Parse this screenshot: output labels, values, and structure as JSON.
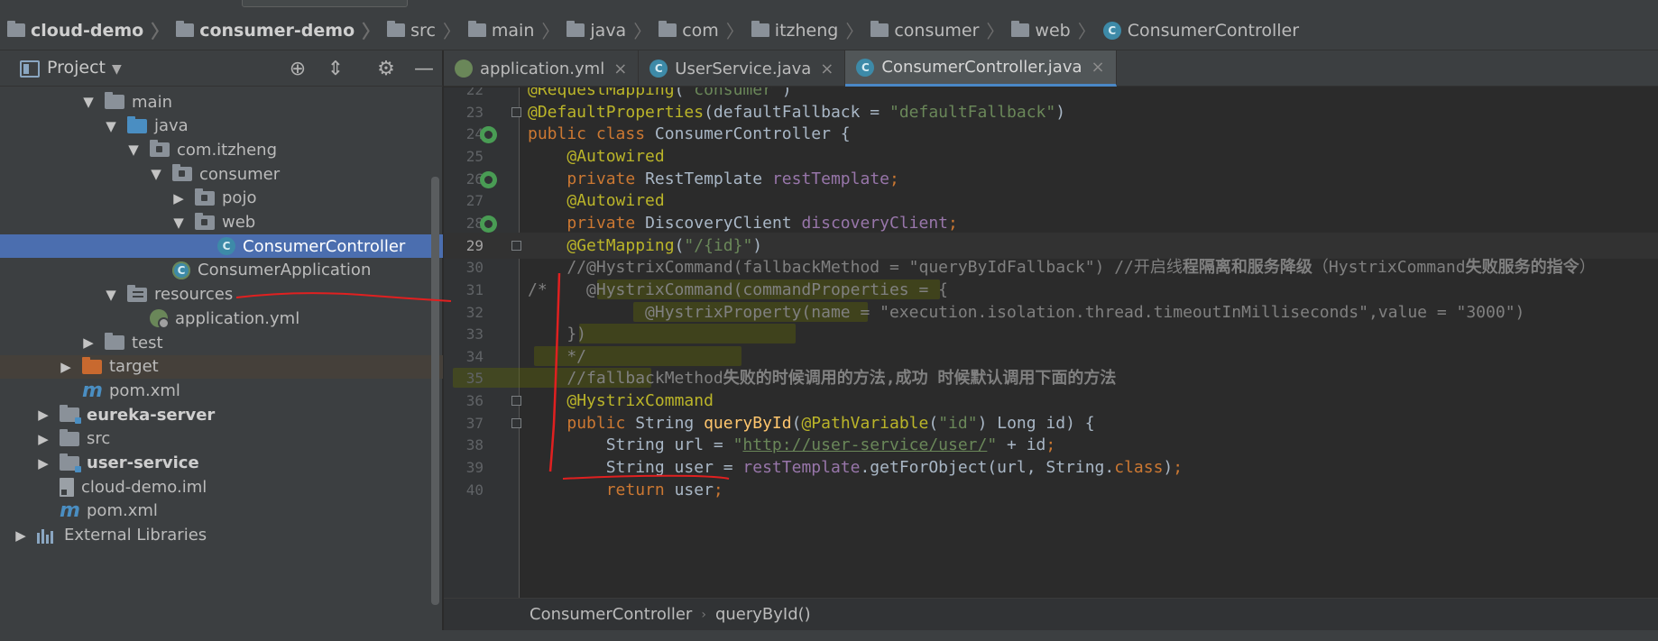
{
  "breadcrumb": [
    {
      "label": "cloud-demo",
      "icon": "module-folder-icon",
      "bold": true
    },
    {
      "label": "consumer-demo",
      "icon": "module-folder-icon",
      "bold": true
    },
    {
      "label": "src",
      "icon": "folder-icon",
      "bold": false
    },
    {
      "label": "main",
      "icon": "folder-icon",
      "bold": false
    },
    {
      "label": "java",
      "icon": "folder-icon",
      "bold": false
    },
    {
      "label": "com",
      "icon": "folder-icon",
      "bold": false
    },
    {
      "label": "itzheng",
      "icon": "folder-icon",
      "bold": false
    },
    {
      "label": "consumer",
      "icon": "folder-icon",
      "bold": false
    },
    {
      "label": "web",
      "icon": "folder-icon",
      "bold": false
    },
    {
      "label": "ConsumerController",
      "icon": "class-icon",
      "bold": false
    }
  ],
  "project": {
    "title": "Project",
    "tree": [
      {
        "label": "main",
        "indent": 4,
        "arrow": "down",
        "icon": "folder",
        "state": ""
      },
      {
        "label": "java",
        "indent": 5,
        "arrow": "down",
        "icon": "folder-blue",
        "state": ""
      },
      {
        "label": "com.itzheng",
        "indent": 6,
        "arrow": "down",
        "icon": "folder-pkg",
        "state": ""
      },
      {
        "label": "consumer",
        "indent": 7,
        "arrow": "down",
        "icon": "folder-pkg",
        "state": ""
      },
      {
        "label": "pojo",
        "indent": 8,
        "arrow": "right",
        "icon": "folder-pkg",
        "state": ""
      },
      {
        "label": "web",
        "indent": 8,
        "arrow": "down",
        "icon": "folder-pkg",
        "state": ""
      },
      {
        "label": "ConsumerController",
        "indent": 9,
        "arrow": "none",
        "icon": "class",
        "state": "selected"
      },
      {
        "label": "ConsumerApplication",
        "indent": 7,
        "arrow": "none",
        "icon": "class-app",
        "state": ""
      },
      {
        "label": "resources",
        "indent": 5,
        "arrow": "down",
        "icon": "folder-res",
        "state": ""
      },
      {
        "label": "application.yml",
        "indent": 6,
        "arrow": "none",
        "icon": "yml",
        "state": ""
      },
      {
        "label": "test",
        "indent": 4,
        "arrow": "right",
        "icon": "folder",
        "state": ""
      },
      {
        "label": "target",
        "indent": 3,
        "arrow": "right",
        "icon": "folder-orange",
        "state": "highlight"
      },
      {
        "label": "pom.xml",
        "indent": 3,
        "arrow": "none",
        "icon": "maven",
        "state": ""
      },
      {
        "label": "eureka-server",
        "indent": 2,
        "arrow": "right",
        "icon": "folder-mod",
        "state": "",
        "bold": true
      },
      {
        "label": "src",
        "indent": 2,
        "arrow": "right",
        "icon": "folder",
        "state": ""
      },
      {
        "label": "user-service",
        "indent": 2,
        "arrow": "right",
        "icon": "folder-mod",
        "state": "",
        "bold": true
      },
      {
        "label": "cloud-demo.iml",
        "indent": 2,
        "arrow": "none",
        "icon": "iml",
        "state": ""
      },
      {
        "label": "pom.xml",
        "indent": 2,
        "arrow": "none",
        "icon": "maven",
        "state": ""
      },
      {
        "label": "External Libraries",
        "indent": 1,
        "arrow": "right",
        "icon": "library",
        "state": ""
      }
    ]
  },
  "tabs": [
    {
      "label": "application.yml",
      "icon": "yml",
      "active": false
    },
    {
      "label": "UserService.java",
      "icon": "class",
      "active": false
    },
    {
      "label": "ConsumerController.java",
      "icon": "class",
      "active": true
    }
  ],
  "editor": {
    "lines": [
      {
        "n": "22",
        "tokens": [
          [
            "ann",
            "@RequestMapping"
          ],
          [
            "name",
            "("
          ],
          [
            "str",
            "\"consumer\""
          ],
          [
            "name",
            ")"
          ]
        ]
      },
      {
        "n": "23",
        "fold": true,
        "tokens": [
          [
            "ann",
            "@DefaultProperties"
          ],
          [
            "name",
            "(defaultFallback = "
          ],
          [
            "str",
            "\"defaultFallback\""
          ],
          [
            "name",
            ")"
          ]
        ]
      },
      {
        "n": "24",
        "gutter": "bean",
        "tokens": [
          [
            "kw",
            "public class "
          ],
          [
            "name",
            "ConsumerController {"
          ]
        ]
      },
      {
        "n": "25",
        "tokens": [
          [
            "name",
            "    "
          ],
          [
            "ann",
            "@Autowired"
          ]
        ]
      },
      {
        "n": "26",
        "gutter": "bean",
        "tokens": [
          [
            "name",
            "    "
          ],
          [
            "kw",
            "private "
          ],
          [
            "name",
            "RestTemplate "
          ],
          [
            "field",
            "restTemplate"
          ],
          [
            "kw",
            ";"
          ]
        ]
      },
      {
        "n": "27",
        "tokens": [
          [
            "name",
            "    "
          ],
          [
            "ann",
            "@Autowired"
          ]
        ]
      },
      {
        "n": "28",
        "gutter": "bean",
        "tokens": [
          [
            "name",
            "    "
          ],
          [
            "kw",
            "private "
          ],
          [
            "name",
            "DiscoveryClient "
          ],
          [
            "field",
            "discoveryClient"
          ],
          [
            "kw",
            ";"
          ]
        ]
      },
      {
        "n": "29",
        "fold": true,
        "current": true,
        "tokens": [
          [
            "name",
            "    "
          ],
          [
            "ann",
            "@GetMapping"
          ],
          [
            "name",
            "("
          ],
          [
            "str",
            "\"/{id}\""
          ],
          [
            "name",
            ")"
          ]
        ]
      },
      {
        "n": "30",
        "tokens": [
          [
            "com",
            "    //@HystrixCommand(fallbackMethod = \"queryByIdFallback\") //开启线"
          ],
          [
            "comb",
            "程隔离和服务降级"
          ],
          [
            "com",
            "（HystrixCommand"
          ],
          [
            "comb",
            "失败服务的指令"
          ],
          [
            "com",
            "）"
          ]
        ]
      },
      {
        "n": "31",
        "tokens": [
          [
            "com",
            "/*    @HystrixCommand(commandProperties = {"
          ]
        ]
      },
      {
        "n": "32",
        "tokens": [
          [
            "com",
            "            @HystrixProperty(name = \"execution.isolation.thread.timeoutInMilliseconds\",value = \"3000\")"
          ]
        ]
      },
      {
        "n": "33",
        "tokens": [
          [
            "com",
            "    })"
          ]
        ]
      },
      {
        "n": "34",
        "tokens": [
          [
            "com",
            "    */"
          ]
        ]
      },
      {
        "n": "35",
        "tokens": [
          [
            "com",
            "    //fallbackMethod"
          ],
          [
            "comb",
            "失败的时候调用的方法,成功 时候默认调用下面的方法"
          ]
        ]
      },
      {
        "n": "36",
        "fold": true,
        "tokens": [
          [
            "name",
            "    "
          ],
          [
            "ann",
            "@HystrixCommand"
          ]
        ]
      },
      {
        "n": "37",
        "fold": true,
        "tokens": [
          [
            "name",
            "    "
          ],
          [
            "kw",
            "public "
          ],
          [
            "name",
            "String "
          ],
          [
            "meth",
            "queryById"
          ],
          [
            "name",
            "("
          ],
          [
            "ann",
            "@PathVariable"
          ],
          [
            "name",
            "("
          ],
          [
            "str",
            "\"id\""
          ],
          [
            "name",
            ") Long id) {"
          ]
        ]
      },
      {
        "n": "38",
        "tokens": [
          [
            "name",
            "        String url = "
          ],
          [
            "str",
            "\""
          ],
          [
            "url",
            "http://user-service/user/"
          ],
          [
            "str",
            "\""
          ],
          [
            "name",
            " + id"
          ],
          [
            "kw",
            ";"
          ]
        ]
      },
      {
        "n": "39",
        "tokens": [
          [
            "name",
            "        String user = "
          ],
          [
            "field",
            "restTemplate"
          ],
          [
            "name",
            ".getForObject(url, String."
          ],
          [
            "kw",
            "class"
          ],
          [
            "name",
            ")"
          ],
          [
            "kw",
            ";"
          ]
        ]
      },
      {
        "n": "40",
        "tokens": [
          [
            "name",
            "        "
          ],
          [
            "kw",
            "return "
          ],
          [
            "name",
            "user"
          ],
          [
            "kw",
            ";"
          ]
        ]
      }
    ]
  },
  "editor_breadcrumb": [
    "ConsumerController",
    "queryById()"
  ]
}
